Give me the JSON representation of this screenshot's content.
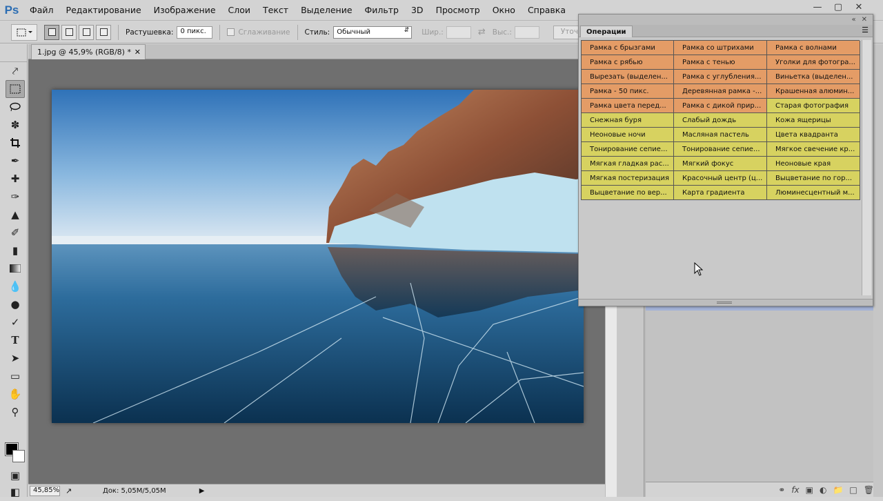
{
  "app": {
    "logo": "Ps"
  },
  "menu": [
    "Файл",
    "Редактирование",
    "Изображение",
    "Слои",
    "Текст",
    "Выделение",
    "Фильтр",
    "3D",
    "Просмотр",
    "Окно",
    "Справка"
  ],
  "window_controls": [
    "minimize-icon",
    "maximize-icon",
    "close-icon"
  ],
  "options": {
    "feather_label": "Растушевка:",
    "feather_value": "0 пикс.",
    "antialias_label": "Сглаживание",
    "style_label": "Стиль:",
    "style_value": "Обычный",
    "width_label": "Шир.:",
    "height_label": "Выс.:",
    "refine_label": "Уточн"
  },
  "document": {
    "tab_title": "1.jpg @ 45,9% (RGB/8) *",
    "zoom": "45,85%",
    "doc_info": "Док: 5,05M/5,05M"
  },
  "actions_panel": {
    "tab_label": "Операции",
    "colors": {
      "orange": "#e49c66",
      "yellow": "#d7d260"
    },
    "rows": [
      {
        "color": "orange",
        "cells": [
          "Рамка с брызгами",
          "Рамка со штрихами",
          "Рамка с волнами"
        ]
      },
      {
        "color": "orange",
        "cells": [
          "Рамка с рябью",
          "Рамка с тенью",
          "Уголки для фотогра..."
        ]
      },
      {
        "color": "orange",
        "cells": [
          "Вырезать (выделен...",
          "Рамка с углубления...",
          "Виньетка (выделен..."
        ]
      },
      {
        "color": "orange",
        "cells": [
          "Рамка - 50 пикс.",
          "Деревянная рамка -...",
          "Крашенная алюмин..."
        ]
      },
      {
        "color": "mixed",
        "cells": [
          "Рамка цвета перед...",
          "Рамка с дикой прир...",
          "Старая фотография"
        ]
      },
      {
        "color": "yellow",
        "cells": [
          "Снежная буря",
          "Слабый дождь",
          "Кожа ящерицы"
        ]
      },
      {
        "color": "yellow",
        "cells": [
          "Неоновые ночи",
          "Масляная пастель",
          "Цвета квадранта"
        ]
      },
      {
        "color": "yellow",
        "cells": [
          "Тонирование сепие...",
          "Тонирование сепие...",
          "Мягкое свечение кр..."
        ]
      },
      {
        "color": "yellow",
        "cells": [
          "Мягкая гладкая рас...",
          "Мягкий фокус",
          "Неоновые края"
        ]
      },
      {
        "color": "yellow",
        "cells": [
          "Мягкая постеризация",
          "Красочный центр (ц...",
          "Выцветание по гор..."
        ]
      },
      {
        "color": "yellow",
        "cells": [
          "Выцветание по вер...",
          "Карта градиента",
          "Люминесцентный м..."
        ]
      }
    ]
  },
  "layers_footer_icons": [
    "link-icon",
    "fx-icon",
    "mask-icon",
    "adjustment-icon",
    "group-icon",
    "new-layer-icon",
    "trash-icon"
  ]
}
